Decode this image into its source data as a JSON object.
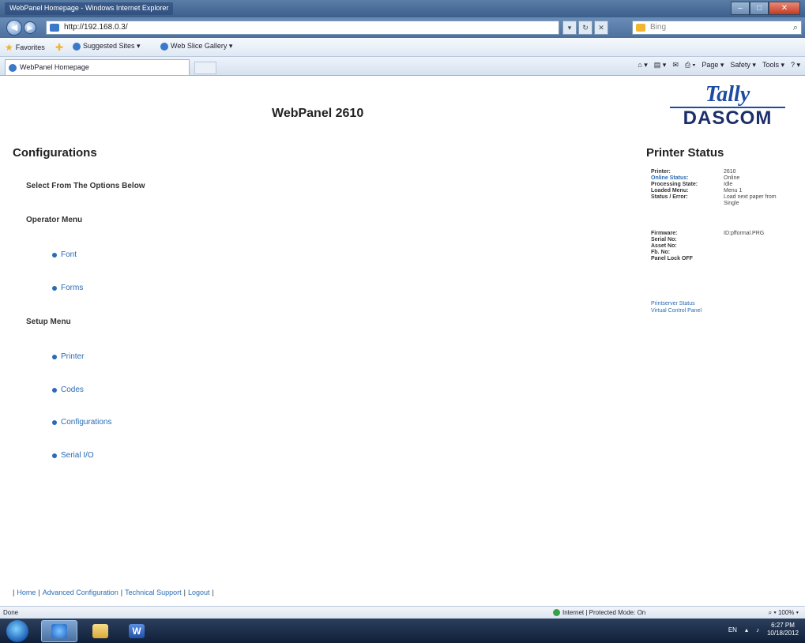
{
  "browser": {
    "window_title": "WebPanel Homepage - Windows Internet Explorer",
    "address": "http://192.168.0.3/",
    "search_placeholder": "Bing",
    "tab_title": "WebPanel Homepage",
    "favorites": {
      "favorites_label": "Favorites",
      "suggested_sites": "Suggested Sites ▾",
      "web_slice_gallery": "Web Slice Gallery ▾"
    },
    "commands": [
      "Page ▾",
      "Safety ▾",
      "Tools ▾"
    ],
    "status_text": "Done",
    "zone_text": "Internet | Protected Mode: On",
    "zoom_text": "100%"
  },
  "page": {
    "title": "WebPanel 2610",
    "logo": {
      "top": "Tally",
      "bottom": "DASCOM"
    },
    "configurations_heading": "Configurations",
    "options_hint": "Select From The Options Below",
    "operator_menu": {
      "label": "Operator Menu",
      "links": [
        "Font",
        "Forms"
      ]
    },
    "setup_menu": {
      "label": "Setup Menu",
      "links": [
        "Printer",
        "Codes",
        "Configurations",
        "Serial I/O"
      ]
    },
    "printer_status": {
      "heading": "Printer Status",
      "rows": [
        {
          "label": "Printer:",
          "value": "2610"
        },
        {
          "label": "Online Status:",
          "value": "Online"
        },
        {
          "label": "Processing State:",
          "value": "Idle"
        },
        {
          "label": "Loaded Menu:",
          "value": "Menu 1"
        },
        {
          "label": "Status / Error:",
          "value": "Load next paper from Single"
        },
        {
          "label": "Firmware:",
          "value": "ID:pfformal.PRG"
        },
        {
          "label": "Serial No:",
          "value": ""
        },
        {
          "label": "Asset No:",
          "value": ""
        },
        {
          "label": "Fb. No:",
          "value": ""
        },
        {
          "label": "Panel Lock OFF",
          "value": ""
        }
      ],
      "links": [
        "Printserver Status",
        "Virtual Control Panel"
      ]
    },
    "footer_links": [
      "Home",
      "Advanced Configuration",
      "Technical Support",
      "Logout"
    ]
  },
  "taskbar": {
    "language": "EN",
    "time": "6:27 PM",
    "date": "10/18/2012"
  }
}
